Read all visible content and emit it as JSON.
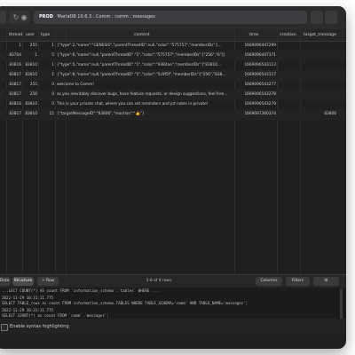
{
  "address_bar": {
    "env": "PROD",
    "text": "MariaDB 10.6.3 : Comm : comm : messages"
  },
  "columns": [
    "thread",
    "user",
    "type",
    "content",
    "time",
    "creation",
    "target_message"
  ],
  "rows": [
    [
      "08",
      "1",
      "255",
      "1",
      "{\"type\":2,\"name\":\"GENESIS\",\"parentThreadID\":null,\"color\":\"575757\",\"memberIDs\":[...",
      "1669096447299",
      "",
      ""
    ],
    [
      "08",
      "83704",
      "1",
      "5",
      "{\"type\":6,\"name\":null,\"parentThreadID\":\"1\",\"color\":\"575757\",\"memberIDs\":[\"256\",\"6\"]]",
      "1669096447371",
      "",
      ""
    ],
    [
      "31",
      "83816",
      "83810",
      "1",
      "{\"type\":5,\"name\":null,\"parentThreadID\":\"1\",\"color\":\"9384ae\",\"memberIDs\":[\"83810...",
      "1669096543113",
      "",
      ""
    ],
    [
      "34",
      "83817",
      "83810",
      "1",
      "{\"type\":8,\"name\":null,\"parentThreadID\":\"1\",\"color\":\"5c9f5f\",\"memberIDs\":[\"256\",\"838...",
      "1669096543117",
      "",
      ""
    ],
    [
      "04",
      "83817",
      "255",
      "0",
      "welcome to Comm!",
      "1669096543277",
      "",
      ""
    ],
    [
      "86",
      "83817",
      "256",
      "0",
      "as you inevitably discover bugs, have feature requests, or design suggestions, feel free...",
      "1669096543278",
      "",
      ""
    ],
    [
      "03",
      "83816",
      "83810",
      "0",
      "This is your private chat, where you can set reminders and jot notes in private!",
      "1669096543279",
      "",
      ""
    ],
    [
      "03",
      "83817",
      "83810",
      "15",
      "{\"targetMessageID\":\"83806\",\"reaction\":\"👍\"}",
      "1669097360374",
      "",
      "83806"
    ]
  ],
  "footer": {
    "data_tab": "Data",
    "structure_tab": "Structure",
    "add_row": "+ Row",
    "count": "1-8 of 8 rows",
    "columns_btn": "Columns",
    "filters_btn": "Filters",
    "gear_icon": "gear-icon"
  },
  "console": [
    "  ...LECT COUNT(*) AS count FROM `information_schema`.`tables` WHERE ...",
    "2022-11-29 10:31:11.775",
    "SELECT TABLE_rows as count FROM information_schema.TABLES WHERE TABLE_SCHEMA='comm' AND TABLE_NAME='messages';",
    "2022-11-29 10:31:11.775",
    "SELECT COUNT(*) as count FROM `comm`.`messages`;"
  ],
  "syntax_highlight": {
    "label": "Enable syntax highlighting",
    "checked": false
  }
}
